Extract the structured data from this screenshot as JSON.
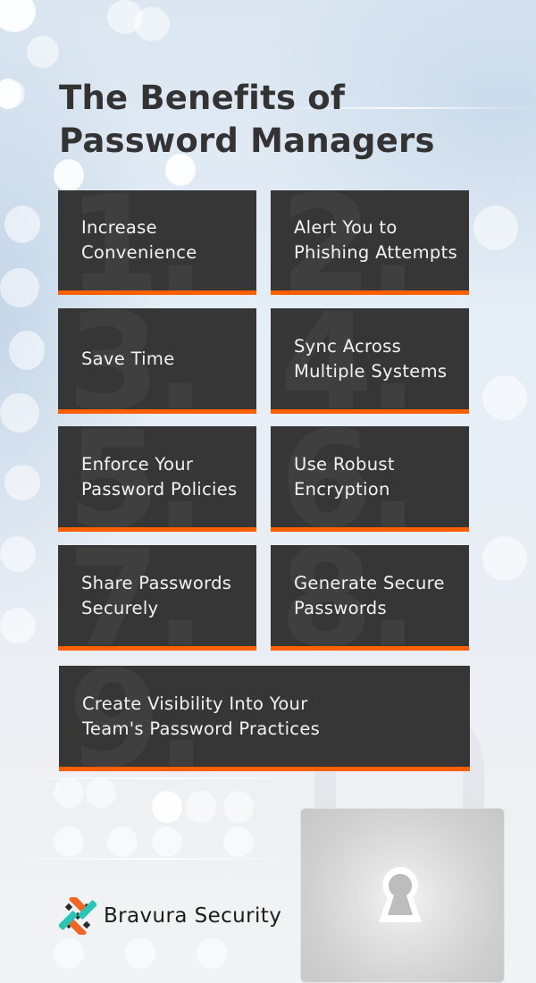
{
  "header": {
    "title_line1": "The Benefits of",
    "title_line2": "Password Managers"
  },
  "benefits": [
    {
      "number": "1.",
      "label": "Increase Convenience"
    },
    {
      "number": "2.",
      "label": "Alert You to Phishing Attempts"
    },
    {
      "number": "3.",
      "label": "Save Time"
    },
    {
      "number": "4.",
      "label": "Sync Across Multiple Systems"
    },
    {
      "number": "5.",
      "label": "Enforce Your Password Policies"
    },
    {
      "number": "6.",
      "label": "Use Robust Encryption"
    },
    {
      "number": "7.",
      "label": "Share Passwords Securely"
    },
    {
      "number": "8.",
      "label": "Generate Secure Passwords"
    },
    {
      "number": "9.",
      "label": "Create Visibility Into Your Team's Password Practices"
    }
  ],
  "benefit_lines": [
    [
      "Increase",
      "Convenience"
    ],
    [
      "Alert You to",
      "Phishing Attempts"
    ],
    [
      "Save Time"
    ],
    [
      "Sync Across",
      "Multiple Systems"
    ],
    [
      "Enforce Your",
      "Password Policies"
    ],
    [
      "Use Robust",
      "Encryption"
    ],
    [
      "Share Passwords",
      "Securely"
    ],
    [
      "Generate Secure",
      "Passwords"
    ],
    [
      "Create Visibility Into Your",
      "Team's Password Practices"
    ]
  ],
  "decor": {
    "lock_icon": "padlock-keyhole-icon"
  },
  "brand": {
    "name": "Bravura Security",
    "logo_icon": "bravura-woven-knot-icon"
  },
  "colors": {
    "card_background": "#363636",
    "card_accent": "#fb5f00",
    "title_text": "#333333",
    "card_text": "#f2f2f2",
    "logo_orange": "#f26522",
    "logo_teal": "#2cc5b5"
  }
}
